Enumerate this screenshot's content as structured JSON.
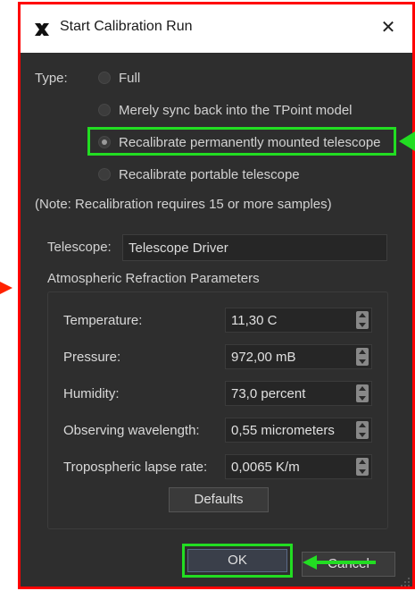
{
  "window": {
    "title": "Start Calibration Run",
    "close_glyph": "✕"
  },
  "type_label": "Type:",
  "radio_options": [
    {
      "label": "Full",
      "checked": false
    },
    {
      "label": "Merely sync back into the TPoint model",
      "checked": false
    },
    {
      "label": "Recalibrate permanently mounted telescope",
      "checked": true
    },
    {
      "label": "Recalibrate portable telescope",
      "checked": false
    }
  ],
  "note": "(Note: Recalibration requires 15 or more samples)",
  "telescope": {
    "label": "Telescope:",
    "value": "Telescope Driver"
  },
  "atmo": {
    "title": "Atmospheric Refraction Parameters",
    "params": [
      {
        "label": "Temperature:",
        "value": "11,30 C"
      },
      {
        "label": "Pressure:",
        "value": "972,00 mB"
      },
      {
        "label": "Humidity:",
        "value": "73,0 percent"
      },
      {
        "label": "Observing wavelength:",
        "value": "0,55 micrometers"
      },
      {
        "label": "Tropospheric lapse rate:",
        "value": "0,0065 K/m"
      }
    ],
    "defaults_label": "Defaults"
  },
  "buttons": {
    "ok": "OK",
    "cancel": "Cancel"
  },
  "colors": {
    "highlight": "#22dd22",
    "annotation": "#ff0000",
    "dialog_bg": "#2e2e2e"
  }
}
